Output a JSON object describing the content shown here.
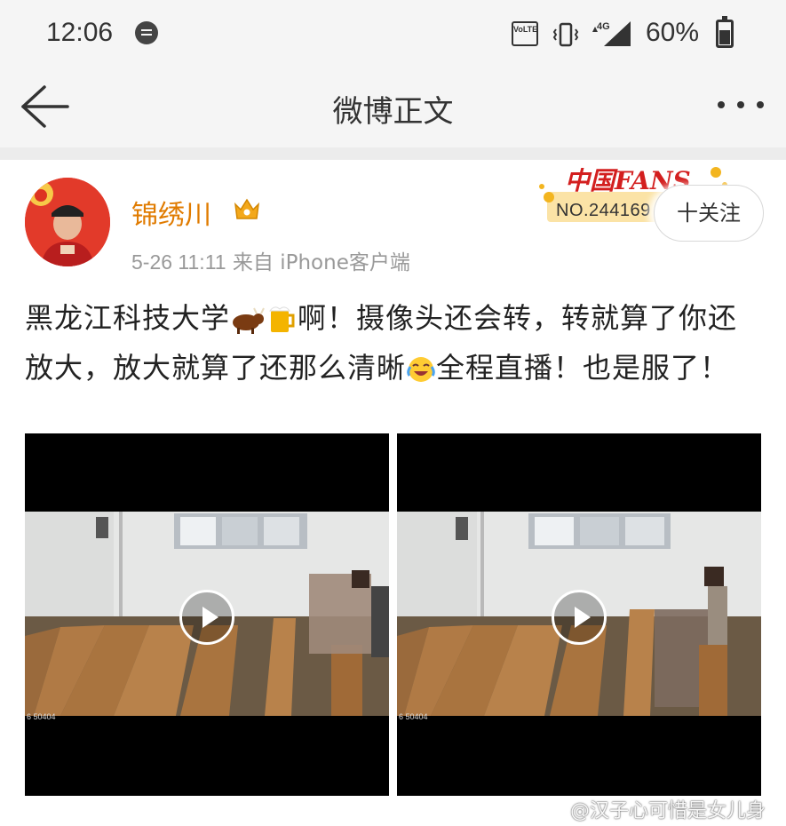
{
  "status_bar": {
    "time": "12:06",
    "volte": "VoLTE",
    "network": "4G",
    "battery_percent": "60%",
    "battery_level": 0.6
  },
  "header": {
    "title": "微博正文"
  },
  "post": {
    "username": "锦绣川",
    "date": "5-26 11:11",
    "source": "来自 iPhone客户端",
    "fans_badge_logo": "中国FANS",
    "fans_badge_number": "NO.244169",
    "follow_label": "十关注",
    "text_part1": "黑龙江科技大学",
    "text_part2": "啊！摄像头还会转，转就算了你还放大，放大就算了还那么清晰",
    "text_part3": "全程直播！也是服了！",
    "video_timestamp_1": "6 50404",
    "video_timestamp_2": "6 50404"
  },
  "watermark": {
    "text": "@汉子心可惜是女儿身"
  },
  "colors": {
    "username": "#e07b00",
    "meta": "#999999",
    "fans_red": "#d31f1f",
    "bar_bg": "#f5f5f5"
  }
}
